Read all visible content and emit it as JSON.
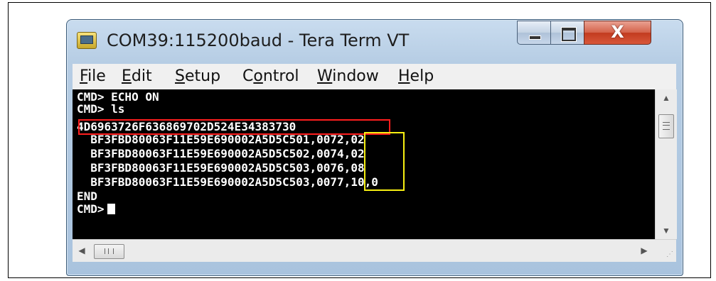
{
  "window": {
    "title": "COM39:115200baud - Tera Term VT",
    "close_glyph": "X",
    "icons": {
      "app": "tera-term-icon",
      "minimize": "minimize-icon",
      "maximize": "maximize-icon",
      "close": "close-icon"
    }
  },
  "menu": {
    "items": [
      {
        "mnemonic": "F",
        "rest": "ile"
      },
      {
        "mnemonic": "E",
        "rest": "dit"
      },
      {
        "mnemonic": "S",
        "rest": "etup"
      },
      {
        "pre": "C",
        "mnemonic": "o",
        "rest": "ntrol"
      },
      {
        "mnemonic": "W",
        "rest": "indow"
      },
      {
        "mnemonic": "H",
        "rest": "elp"
      }
    ]
  },
  "terminal": {
    "lines": [
      "CMD> ECHO ON",
      "CMD> ls",
      "4D6963726F636869702D524E34383730",
      "  BF3FBD80063F11E59E690002A5D5C501,0072,02",
      "  BF3FBD80063F11E59E690002A5D5C502,0074,02",
      "  BF3FBD80063F11E59E690002A5D5C503,0076,08",
      "  BF3FBD80063F11E59E690002A5D5C503,0077,10,0",
      "END",
      "CMD>"
    ],
    "highlight_colors": {
      "red": "#ff1e1e",
      "yellow": "#f7ef12"
    },
    "background": "#000000",
    "foreground": "#ffffff"
  },
  "scrollbars": {
    "vertical": {
      "up": "▲",
      "down": "▼"
    },
    "horizontal": {
      "left": "◀",
      "right": "▶"
    },
    "grip": "⋰"
  }
}
